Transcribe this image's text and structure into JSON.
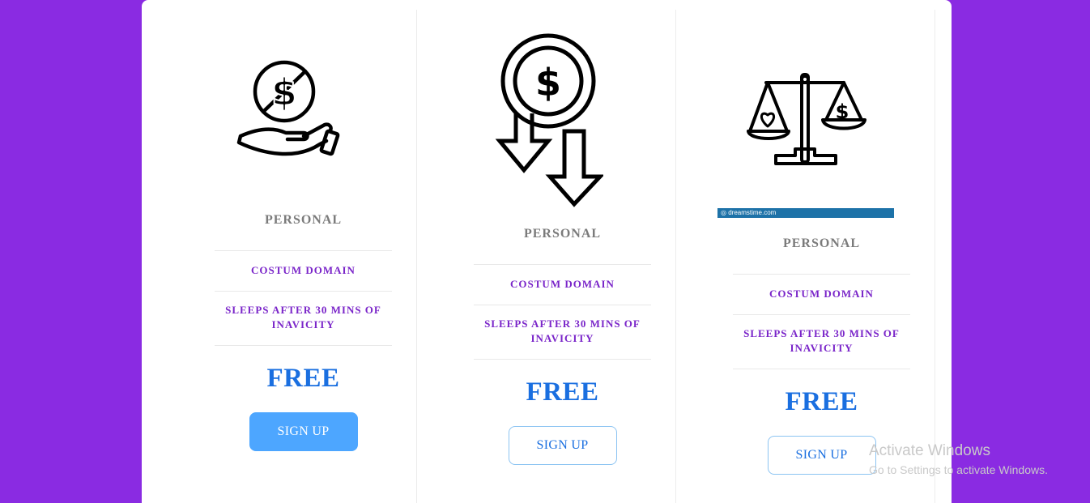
{
  "cards": [
    {
      "icon": "hand-no-dollar-icon",
      "title": "PERSONAL",
      "features": [
        "COSTUM DOMAIN",
        "SLEEPS AFTER 30 MINS OF INAVICITY"
      ],
      "price": "FREE",
      "button": "SIGN UP",
      "button_style": "filled"
    },
    {
      "icon": "coin-down-arrows-icon",
      "title": "PERSONAL",
      "features": [
        "COSTUM DOMAIN",
        "SLEEPS AFTER 30 MINS OF INAVICITY"
      ],
      "price": "FREE",
      "button": "SIGN UP",
      "button_style": "outline"
    },
    {
      "icon": "balance-scale-heart-dollar-icon",
      "title": "PERSONAL",
      "features": [
        "COSTUM DOMAIN",
        "SLEEPS AFTER 30 MINS OF INAVICITY"
      ],
      "price": "FREE",
      "button": "SIGN UP",
      "button_style": "outline",
      "image_banner": "dreamstime.com"
    }
  ],
  "watermark": {
    "line1": "Activate Windows",
    "line2": "Go to Settings to activate Windows."
  },
  "colors": {
    "background": "#8a2be2",
    "feature_text": "#7a25c9",
    "price_text": "#1a6fe0",
    "button_filled": "#4da6ff"
  }
}
